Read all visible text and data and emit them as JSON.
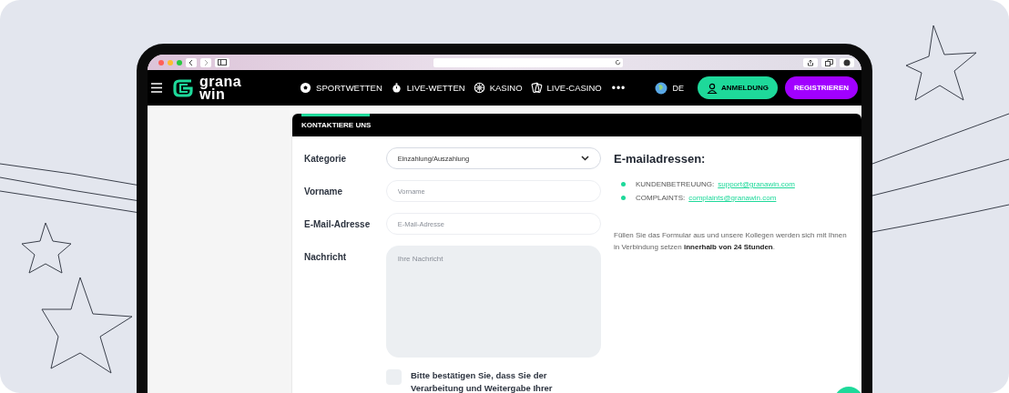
{
  "nav": {
    "logo": [
      "grana",
      "win"
    ],
    "items": [
      {
        "label": "SPORTWETTEN"
      },
      {
        "label": "LIVE-WETTEN"
      },
      {
        "label": "KASINO"
      },
      {
        "label": "LIVE-CASINO"
      }
    ],
    "more": "•••",
    "language": "DE",
    "login": "ANMELDUNG",
    "register": "REGISTRIEREN"
  },
  "form": {
    "title": "KONTAKTIERE UNS",
    "fields": [
      {
        "label": "Kategorie",
        "kind": "select",
        "value": "Einzahlung/Auszahlung"
      },
      {
        "label": "Vorname",
        "kind": "input",
        "placeholder": "Vorname"
      },
      {
        "label": "E-Mail-Adresse",
        "kind": "input",
        "placeholder": "E-Mail-Adresse"
      },
      {
        "label": "Nachricht",
        "kind": "textarea",
        "placeholder": "Ihre Nachricht"
      }
    ],
    "consent": {
      "text": "Bitte bestätigen Sie, dass Sie der Verarbeitung und Weitergabe Ihrer",
      "checked": false
    }
  },
  "contact": {
    "heading": "E-mailadressen:",
    "emails": [
      {
        "label": "KUNDENBETREUUNG:",
        "email": "support@granawin.com"
      },
      {
        "label": "COMPLAINTS:",
        "email": "complaints@granawin.com"
      }
    ],
    "note": "Füllen Sie das Formular aus und unsere Kollegen werden sich mit Ihnen in Verbindung setzen **innerhalb von 24 Stunden**."
  }
}
